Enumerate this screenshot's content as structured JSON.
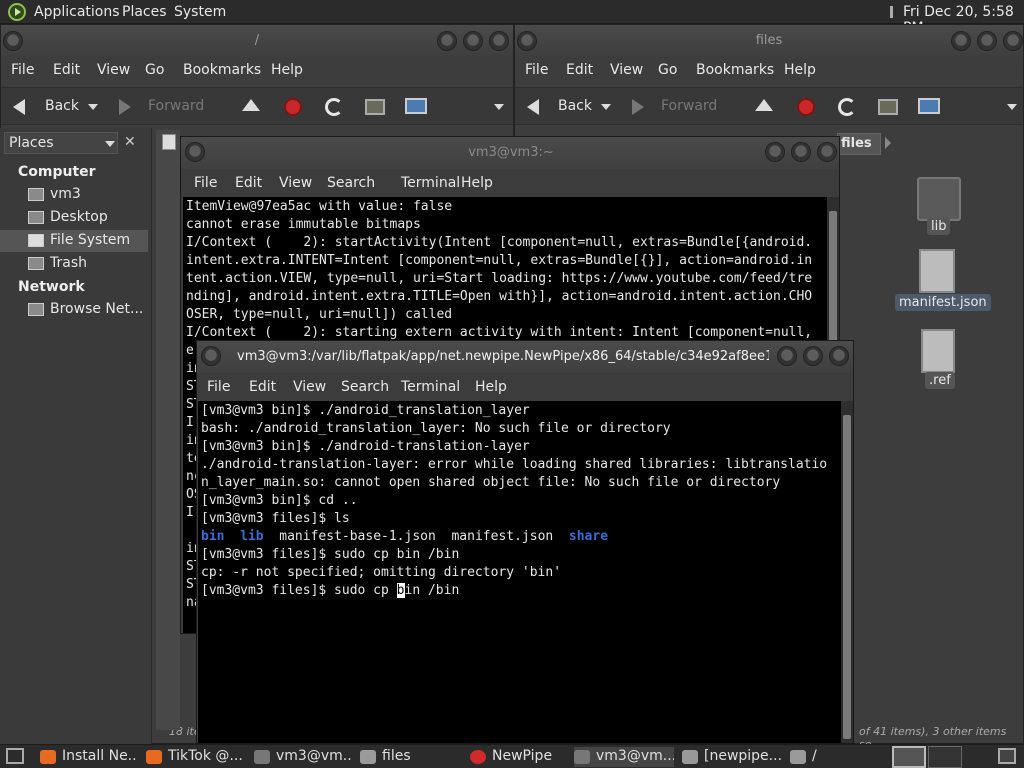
{
  "top_panel": {
    "menus": [
      "Applications",
      "Places",
      "System"
    ],
    "clock": "Fri Dec 20,  5:58 PM"
  },
  "left_window": {
    "title": "/",
    "menus": [
      "File",
      "Edit",
      "View",
      "Go",
      "Bookmarks",
      "Help"
    ],
    "back": "Back",
    "forward": "Forward",
    "status_partial": "18 ite"
  },
  "right_window": {
    "title": "files",
    "menus": [
      "File",
      "Edit",
      "View",
      "Go",
      "Bookmarks",
      "Help"
    ],
    "back": "Back",
    "forward": "Forward",
    "path_tab": "files",
    "status": "of 41 items), 3 other items se...",
    "files": [
      "lib",
      "manifest.json",
      ".ref"
    ]
  },
  "sidebar": {
    "header": "Places",
    "close": "✕",
    "sections": [
      {
        "title": "Computer",
        "items": [
          "vm3",
          "Desktop",
          "File System",
          "Trash"
        ]
      },
      {
        "title": "Network",
        "items": [
          "Browse Net..."
        ]
      }
    ],
    "selected": "File System"
  },
  "terminal_back": {
    "title": "vm3@vm3:~",
    "menus": [
      "File",
      "Edit",
      "View",
      "Search",
      "Terminal",
      "Help"
    ],
    "lines": [
      "ItemView@97ea5ac with value: false",
      "cannot erase immutable bitmaps",
      "I/Context (    2): startActivity(Intent [component=null, extras=Bundle[{android.",
      "intent.extra.INTENT=Intent [component=null, extras=Bundle[{}], action=android.in",
      "tent.action.VIEW, type=null, uri=Start loading: https://www.youtube.com/feed/tre",
      "nding], android.intent.extra.TITLE=Open with}], action=android.intent.action.CHO",
      "OSER, type=null, uri=null]) called",
      "I/Context (    2): starting extern activity with intent: Intent [component=null,"
    ],
    "side_chars": [
      "e",
      "in",
      "ST",
      "ST",
      "I.",
      "in",
      "te",
      "nc",
      "OS",
      "I.",
      " ",
      "in",
      "ST",
      "ST",
      "na"
    ]
  },
  "terminal_front": {
    "title": "vm3@vm3:/var/lib/flatpak/app/net.newpipe.NewPipe/x86_64/stable/c34e92af8ee1...",
    "menus": [
      "File",
      "Edit",
      "View",
      "Search",
      "Terminal",
      "Help"
    ],
    "lines": [
      "[vm3@vm3 bin]$ ./android_translation_layer",
      "bash: ./android_translation_layer: No such file or directory",
      "[vm3@vm3 bin]$ ./android-translation-layer",
      "./android-translation-layer: error while loading shared libraries: libtranslatio",
      "n_layer_main.so: cannot open shared object file: No such file or directory",
      "[vm3@vm3 bin]$ cd ..",
      "[vm3@vm3 files]$ ls"
    ],
    "ls_output": {
      "bin": "bin",
      "lib": "lib",
      "f1": "manifest-base-1.json",
      "f2": "manifest.json",
      "share": "share"
    },
    "lines_after": [
      "[vm3@vm3 files]$ sudo cp bin /bin",
      "cp: -r not specified; omitting directory 'bin'"
    ],
    "prompt_pre": "[vm3@vm3 files]$ sudo cp ",
    "cursor_char": "b",
    "prompt_post": "in /bin"
  },
  "taskbar": {
    "items": [
      {
        "label": "Install Ne...",
        "color": "#e66a1f"
      },
      {
        "label": "TikTok @...",
        "color": "#e66a1f"
      },
      {
        "label": "vm3@vm...",
        "color": "#777777"
      },
      {
        "label": "files",
        "color": "#9a9a9a"
      },
      {
        "label": "NewPipe",
        "color": "#d02a2a"
      },
      {
        "label": "vm3@vm...",
        "color": "#777777"
      },
      {
        "label": "[newpipe....",
        "color": "#999999"
      },
      {
        "label": "/",
        "color": "#9a9a9a"
      }
    ]
  }
}
